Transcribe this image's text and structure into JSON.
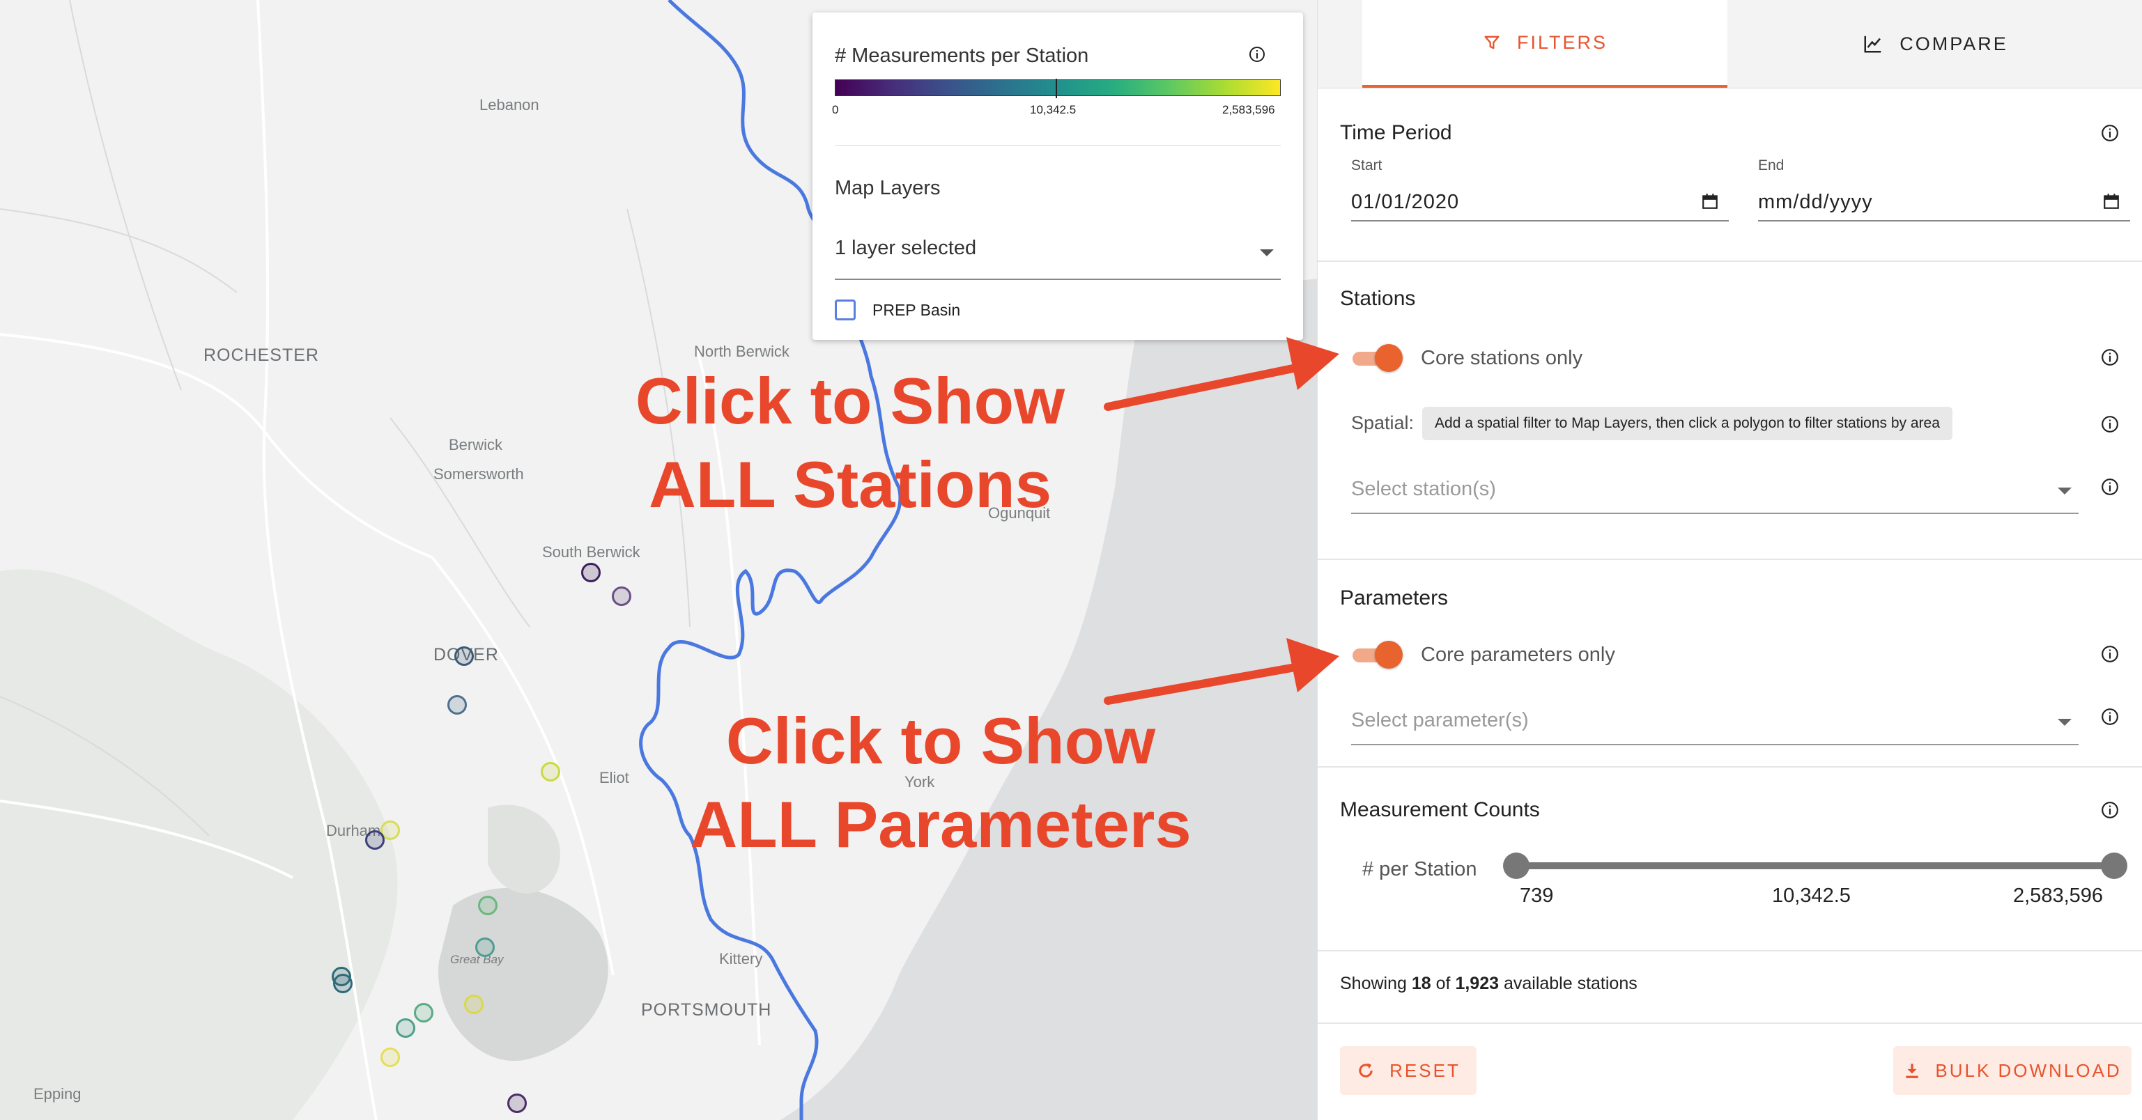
{
  "legend": {
    "title": "# Measurements per Station",
    "scale_min": "0",
    "scale_mid": "10,342.5",
    "scale_max": "2,583,596",
    "colormap": [
      "#440154",
      "#3b518b",
      "#21908d",
      "#5cc863",
      "#fde725"
    ],
    "map_layers_title": "Map Layers",
    "layer_select_value": "1 layer selected",
    "layer_option_label": "PREP Basin",
    "layer_option_checked": false
  },
  "map": {
    "places": [
      "Lebanon",
      "ROCHESTER",
      "North Berwick",
      "Berwick",
      "Somersworth",
      "South Berwick",
      "Ogunquit",
      "DOVER",
      "Eliot",
      "York",
      "Durham",
      "Great Bay",
      "Kittery",
      "PORTSMOUTH",
      "Epping"
    ],
    "station_colors": [
      "#3e1f5e",
      "#6b4e86",
      "#3b5978",
      "#4e6f8e",
      "#cbd84a",
      "#d8dc5a",
      "#3d3f7a",
      "#6ab87d",
      "#4f9c91",
      "#2e6b78",
      "#2e6b78",
      "#5aaa84",
      "#4f9f8a",
      "#d8d84e",
      "#e5de5a",
      "#4a2c68"
    ]
  },
  "annotations": {
    "stations_line1": "Click to Show",
    "stations_line2": "ALL Stations",
    "parameters_line1": "Click to Show",
    "parameters_line2": "ALL Parameters",
    "color": "#e8472c"
  },
  "panel": {
    "tabs": {
      "filters": "FILTERS",
      "compare": "COMPARE",
      "active": "filters"
    },
    "time_period": {
      "title": "Time Period",
      "start_label": "Start",
      "start_value": "01/01/2020",
      "end_label": "End",
      "end_value": "mm/dd/yyyy"
    },
    "stations": {
      "title": "Stations",
      "core_only_label": "Core stations only",
      "core_only_enabled": true,
      "spatial_label": "Spatial:",
      "spatial_hint": "Add a spatial filter to Map Layers, then click a polygon to filter stations by area",
      "select_placeholder": "Select station(s)"
    },
    "parameters": {
      "title": "Parameters",
      "core_only_label": "Core parameters only",
      "core_only_enabled": true,
      "select_placeholder": "Select parameter(s)"
    },
    "measurement_counts": {
      "title": "Measurement Counts",
      "per_station_label": "# per Station",
      "min_label": "739",
      "mid_label": "10,342.5",
      "max_label": "2,583,596"
    },
    "showing": {
      "prefix": "Showing",
      "count": "18",
      "of": "of",
      "total": "1,923",
      "suffix": "available stations"
    },
    "reset_label": "RESET",
    "bulk_download_label": "BULK DOWNLOAD",
    "accent_color": "#e8632d"
  }
}
